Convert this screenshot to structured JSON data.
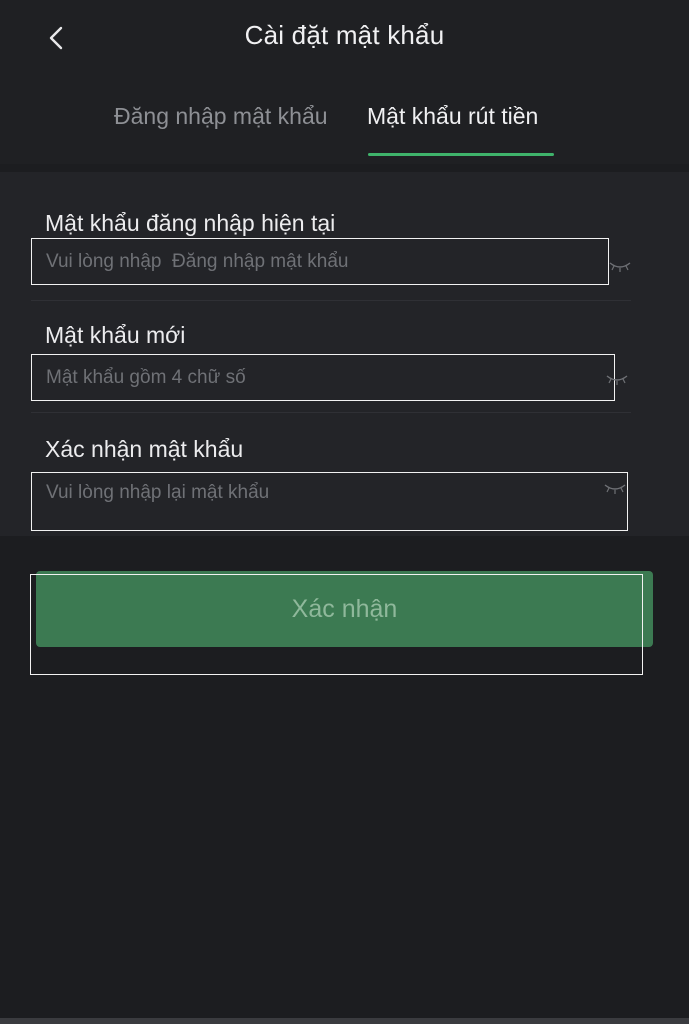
{
  "header": {
    "title": "Cài đặt mật khẩu",
    "back_icon": "chevron-left-icon"
  },
  "tabs": [
    {
      "label": "Đăng nhập mật khẩu",
      "active": false
    },
    {
      "label": "Mật khẩu rút tiền",
      "active": true
    }
  ],
  "form": {
    "current_password": {
      "label": "Mật khẩu đăng nhập hiện tại",
      "placeholder": "Vui lòng nhập  Đăng nhập mật khẩu",
      "value": ""
    },
    "new_password": {
      "label": "Mật khẩu mới",
      "placeholder": "Mật khẩu gồm 4 chữ số",
      "value": ""
    },
    "confirm_password": {
      "label": "Xác nhận mật khẩu",
      "placeholder": "Vui lòng nhập lại mật khẩu",
      "value": ""
    }
  },
  "submit": {
    "label": "Xác nhận"
  },
  "colors": {
    "accent": "#3fb36b",
    "button": "#3c7a52",
    "background": "#1c1d20"
  }
}
